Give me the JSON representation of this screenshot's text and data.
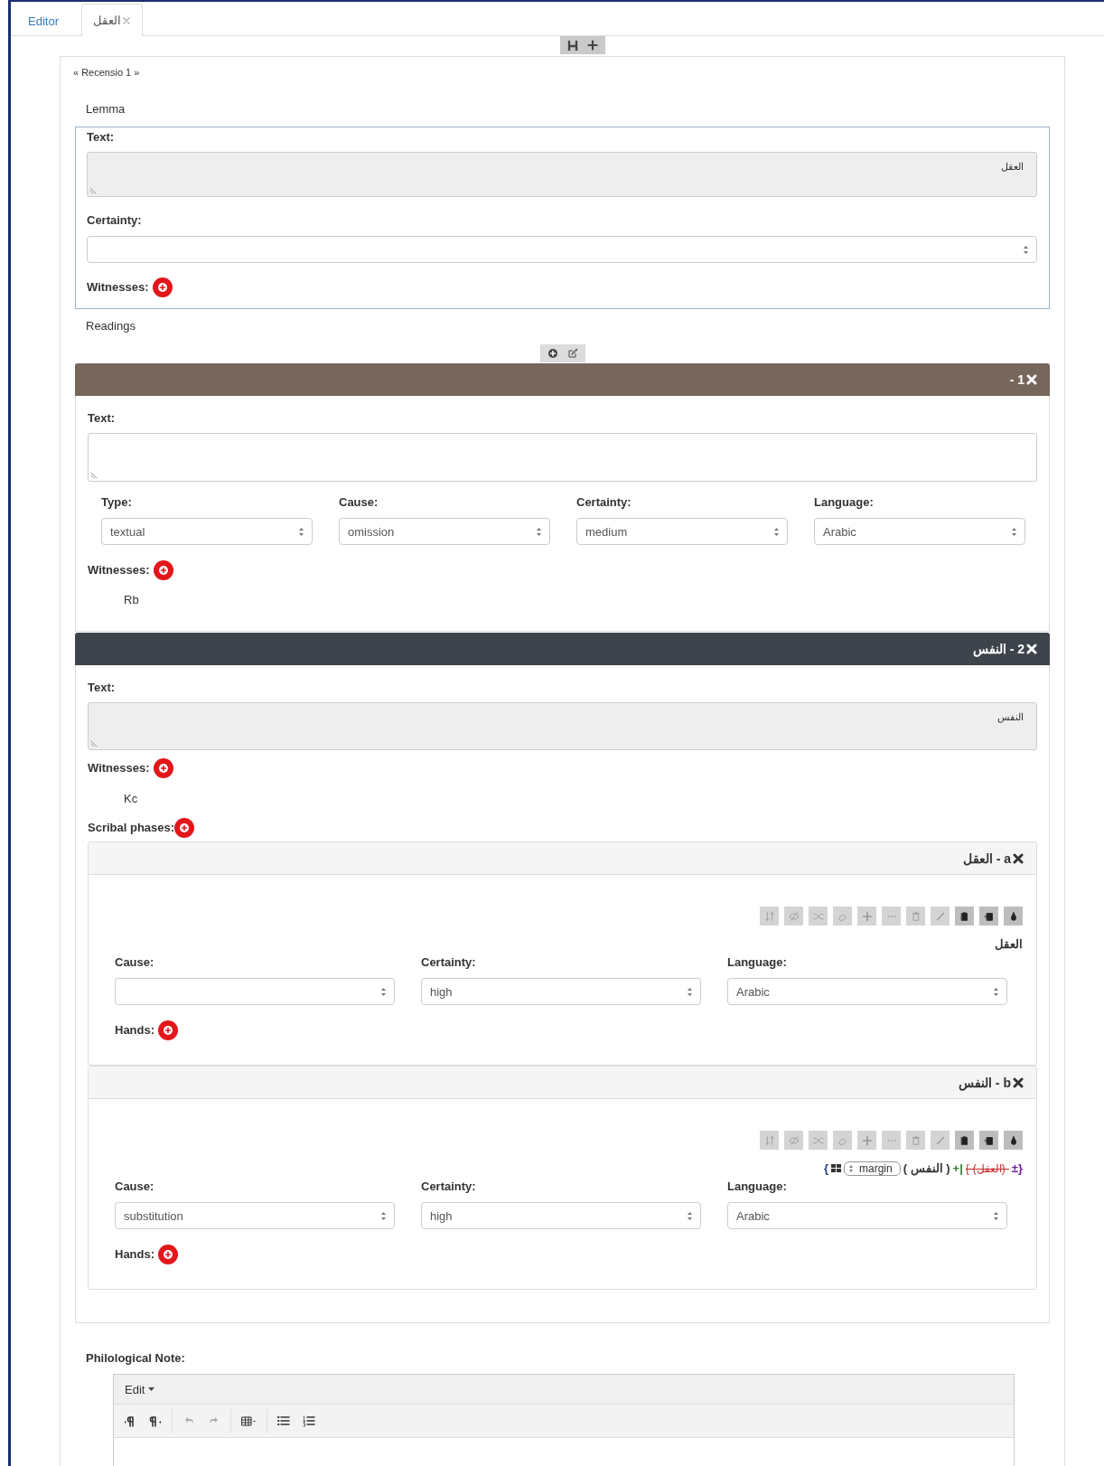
{
  "tabs": [
    {
      "label": "Editor",
      "selected": false,
      "closable": false
    },
    {
      "label": "العقل",
      "selected": true,
      "closable": true
    }
  ],
  "recensio": "« Recensio 1 »",
  "lemma": {
    "heading": "Lemma",
    "text_label": "Text:",
    "text": "العقل",
    "text_readonly": true,
    "certainty_label": "Certainty:",
    "witnesses_label": "Witnesses:"
  },
  "readings_heading": "Readings",
  "readings": [
    {
      "title": "1 -",
      "color": "#76665c",
      "text_label": "Text:",
      "text_readonly": false,
      "fields": [
        {
          "label": "Type:",
          "value": "textual"
        },
        {
          "label": "Cause:",
          "value": "omission"
        },
        {
          "label": "Certainty:",
          "value": "medium"
        },
        {
          "label": "Language:",
          "value": "Arabic"
        }
      ],
      "witnesses_label": "Witnesses:",
      "witnesses": [
        "Rb"
      ]
    },
    {
      "title": "2 - النفس",
      "color": "#3e444b",
      "text_label": "Text:",
      "text": "النفس",
      "text_readonly": true,
      "witnesses_label": "Witnesses:",
      "witnesses": [
        "Kc"
      ],
      "phases_label": "Scribal phases:",
      "phases": [
        {
          "title": "a - العقل",
          "tools": [
            {
              "disabled": true
            },
            {
              "disabled": true
            },
            {
              "disabled": true
            },
            {
              "disabled": true
            },
            {
              "disabled": true
            },
            {
              "disabled": true
            },
            {
              "disabled": true
            },
            {
              "disabled": true
            },
            {
              "disabled": false
            },
            {
              "disabled": false
            },
            {
              "disabled": false
            }
          ],
          "preview": [
            {
              "kind": "text",
              "text": "العقل",
              "color": "#333333"
            }
          ],
          "fields": [
            {
              "label": "Cause:"
            },
            {
              "label": "Certainty:",
              "value": "high"
            },
            {
              "label": "Language:",
              "value": "Arabic"
            }
          ],
          "hands_label": "Hands:"
        },
        {
          "title": "b - النفس",
          "tools": [
            {
              "disabled": true
            },
            {
              "disabled": true
            },
            {
              "disabled": true
            },
            {
              "disabled": true
            },
            {
              "disabled": true
            },
            {
              "disabled": true
            },
            {
              "disabled": true
            },
            {
              "disabled": true
            },
            {
              "disabled": false
            },
            {
              "disabled": false
            },
            {
              "disabled": false
            }
          ],
          "preview": [
            {
              "kind": "text",
              "text": "{",
              "color": "#1f3a8a"
            },
            {
              "kind": "grid"
            },
            {
              "kind": "select",
              "text": "margin"
            },
            {
              "kind": "text",
              "text": "( النفس )",
              "color": "#333333"
            },
            {
              "kind": "text",
              "text": "+|",
              "color": "#2e7d32"
            },
            {
              "kind": "deleted",
              "text": "{-(العقل)-",
              "color": "#c62828"
            },
            {
              "kind": "text",
              "text": "±}",
              "color": "#6a1b9a"
            }
          ],
          "fields": [
            {
              "label": "Cause:",
              "value": "substitution"
            },
            {
              "label": "Certainty:",
              "value": "high"
            },
            {
              "label": "Language:",
              "value": "Arabic"
            }
          ],
          "hands_label": "Hands:"
        }
      ]
    }
  ],
  "note": {
    "label": "Philological Note:",
    "menu": [
      "Edit"
    ],
    "tools": [
      {
        "disabled": false
      },
      {
        "disabled": false
      },
      {
        "disabled": true
      },
      {
        "disabled": true
      },
      {
        "disabled": false
      },
      {
        "disabled": false
      },
      {
        "disabled": false
      }
    ]
  }
}
